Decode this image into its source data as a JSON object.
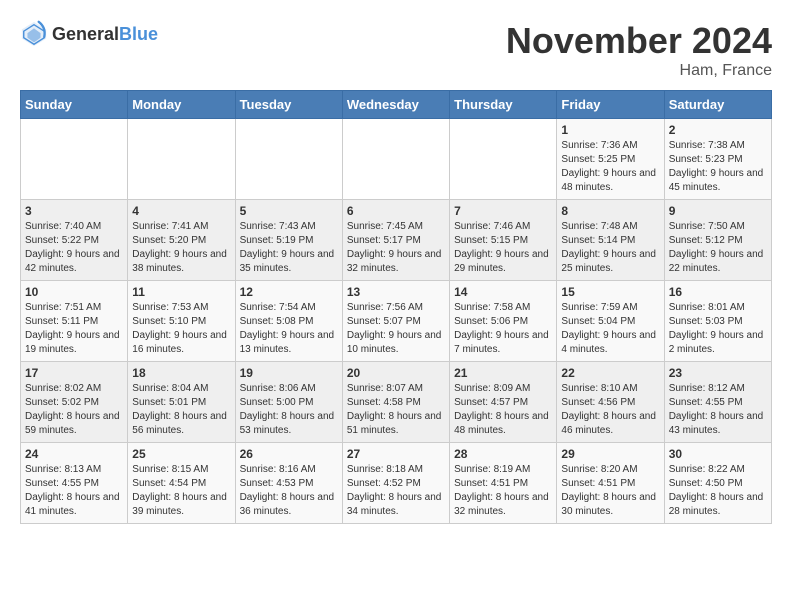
{
  "header": {
    "logo_general": "General",
    "logo_blue": "Blue",
    "month": "November 2024",
    "location": "Ham, France"
  },
  "days_of_week": [
    "Sunday",
    "Monday",
    "Tuesday",
    "Wednesday",
    "Thursday",
    "Friday",
    "Saturday"
  ],
  "weeks": [
    [
      {
        "day": "",
        "info": ""
      },
      {
        "day": "",
        "info": ""
      },
      {
        "day": "",
        "info": ""
      },
      {
        "day": "",
        "info": ""
      },
      {
        "day": "",
        "info": ""
      },
      {
        "day": "1",
        "info": "Sunrise: 7:36 AM\nSunset: 5:25 PM\nDaylight: 9 hours and 48 minutes."
      },
      {
        "day": "2",
        "info": "Sunrise: 7:38 AM\nSunset: 5:23 PM\nDaylight: 9 hours and 45 minutes."
      }
    ],
    [
      {
        "day": "3",
        "info": "Sunrise: 7:40 AM\nSunset: 5:22 PM\nDaylight: 9 hours and 42 minutes."
      },
      {
        "day": "4",
        "info": "Sunrise: 7:41 AM\nSunset: 5:20 PM\nDaylight: 9 hours and 38 minutes."
      },
      {
        "day": "5",
        "info": "Sunrise: 7:43 AM\nSunset: 5:19 PM\nDaylight: 9 hours and 35 minutes."
      },
      {
        "day": "6",
        "info": "Sunrise: 7:45 AM\nSunset: 5:17 PM\nDaylight: 9 hours and 32 minutes."
      },
      {
        "day": "7",
        "info": "Sunrise: 7:46 AM\nSunset: 5:15 PM\nDaylight: 9 hours and 29 minutes."
      },
      {
        "day": "8",
        "info": "Sunrise: 7:48 AM\nSunset: 5:14 PM\nDaylight: 9 hours and 25 minutes."
      },
      {
        "day": "9",
        "info": "Sunrise: 7:50 AM\nSunset: 5:12 PM\nDaylight: 9 hours and 22 minutes."
      }
    ],
    [
      {
        "day": "10",
        "info": "Sunrise: 7:51 AM\nSunset: 5:11 PM\nDaylight: 9 hours and 19 minutes."
      },
      {
        "day": "11",
        "info": "Sunrise: 7:53 AM\nSunset: 5:10 PM\nDaylight: 9 hours and 16 minutes."
      },
      {
        "day": "12",
        "info": "Sunrise: 7:54 AM\nSunset: 5:08 PM\nDaylight: 9 hours and 13 minutes."
      },
      {
        "day": "13",
        "info": "Sunrise: 7:56 AM\nSunset: 5:07 PM\nDaylight: 9 hours and 10 minutes."
      },
      {
        "day": "14",
        "info": "Sunrise: 7:58 AM\nSunset: 5:06 PM\nDaylight: 9 hours and 7 minutes."
      },
      {
        "day": "15",
        "info": "Sunrise: 7:59 AM\nSunset: 5:04 PM\nDaylight: 9 hours and 4 minutes."
      },
      {
        "day": "16",
        "info": "Sunrise: 8:01 AM\nSunset: 5:03 PM\nDaylight: 9 hours and 2 minutes."
      }
    ],
    [
      {
        "day": "17",
        "info": "Sunrise: 8:02 AM\nSunset: 5:02 PM\nDaylight: 8 hours and 59 minutes."
      },
      {
        "day": "18",
        "info": "Sunrise: 8:04 AM\nSunset: 5:01 PM\nDaylight: 8 hours and 56 minutes."
      },
      {
        "day": "19",
        "info": "Sunrise: 8:06 AM\nSunset: 5:00 PM\nDaylight: 8 hours and 53 minutes."
      },
      {
        "day": "20",
        "info": "Sunrise: 8:07 AM\nSunset: 4:58 PM\nDaylight: 8 hours and 51 minutes."
      },
      {
        "day": "21",
        "info": "Sunrise: 8:09 AM\nSunset: 4:57 PM\nDaylight: 8 hours and 48 minutes."
      },
      {
        "day": "22",
        "info": "Sunrise: 8:10 AM\nSunset: 4:56 PM\nDaylight: 8 hours and 46 minutes."
      },
      {
        "day": "23",
        "info": "Sunrise: 8:12 AM\nSunset: 4:55 PM\nDaylight: 8 hours and 43 minutes."
      }
    ],
    [
      {
        "day": "24",
        "info": "Sunrise: 8:13 AM\nSunset: 4:55 PM\nDaylight: 8 hours and 41 minutes."
      },
      {
        "day": "25",
        "info": "Sunrise: 8:15 AM\nSunset: 4:54 PM\nDaylight: 8 hours and 39 minutes."
      },
      {
        "day": "26",
        "info": "Sunrise: 8:16 AM\nSunset: 4:53 PM\nDaylight: 8 hours and 36 minutes."
      },
      {
        "day": "27",
        "info": "Sunrise: 8:18 AM\nSunset: 4:52 PM\nDaylight: 8 hours and 34 minutes."
      },
      {
        "day": "28",
        "info": "Sunrise: 8:19 AM\nSunset: 4:51 PM\nDaylight: 8 hours and 32 minutes."
      },
      {
        "day": "29",
        "info": "Sunrise: 8:20 AM\nSunset: 4:51 PM\nDaylight: 8 hours and 30 minutes."
      },
      {
        "day": "30",
        "info": "Sunrise: 8:22 AM\nSunset: 4:50 PM\nDaylight: 8 hours and 28 minutes."
      }
    ]
  ]
}
